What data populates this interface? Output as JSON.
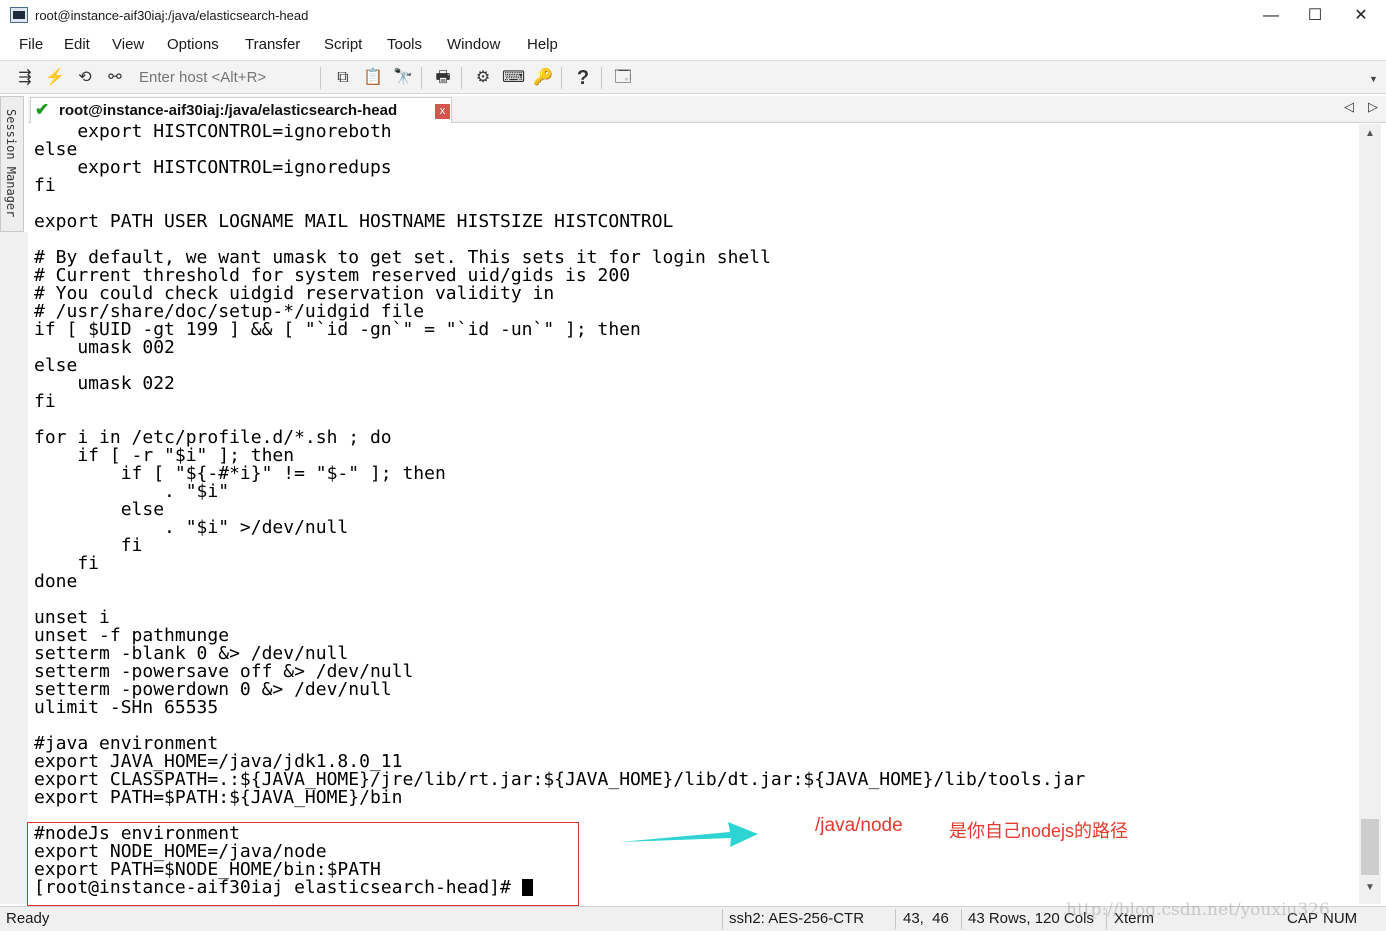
{
  "window": {
    "title": "root@instance-aif30iaj:/java/elasticsearch-head",
    "minimize": "—",
    "maximize": "☐",
    "close": "✕"
  },
  "menu": [
    "File",
    "Edit",
    "View",
    "Options",
    "Transfer",
    "Script",
    "Tools",
    "Window",
    "Help"
  ],
  "toolbar": {
    "host_placeholder": "Enter host <Alt+R>",
    "icons": [
      "connect-icon",
      "quick-connect-icon",
      "reconnect-icon",
      "disconnect-icon",
      "copy-icon",
      "paste-icon",
      "find-icon",
      "print-icon",
      "settings-icon",
      "keymap-icon",
      "key-icon",
      "help-icon",
      "sftp-icon"
    ]
  },
  "session_manager": {
    "label": "Session Manager"
  },
  "tab": {
    "label": "root@instance-aif30iaj:/java/elasticsearch-head",
    "close": "x",
    "prev": "◁",
    "next": "▷"
  },
  "terminal": {
    "lines": [
      "    export HISTCONTROL=ignoreboth",
      "else",
      "    export HISTCONTROL=ignoredups",
      "fi",
      "",
      "export PATH USER LOGNAME MAIL HOSTNAME HISTSIZE HISTCONTROL",
      "",
      "# By default, we want umask to get set. This sets it for login shell",
      "# Current threshold for system reserved uid/gids is 200",
      "# You could check uidgid reservation validity in",
      "# /usr/share/doc/setup-*/uidgid file",
      "if [ $UID -gt 199 ] && [ \"`id -gn`\" = \"`id -un`\" ]; then",
      "    umask 002",
      "else",
      "    umask 022",
      "fi",
      "",
      "for i in /etc/profile.d/*.sh ; do",
      "    if [ -r \"$i\" ]; then",
      "        if [ \"${-#*i}\" != \"$-\" ]; then",
      "            . \"$i\"",
      "        else",
      "            . \"$i\" >/dev/null",
      "        fi",
      "    fi",
      "done",
      "",
      "unset i",
      "unset -f pathmunge",
      "setterm -blank 0 &> /dev/null",
      "setterm -powersave off &> /dev/null",
      "setterm -powerdown 0 &> /dev/null",
      "ulimit -SHn 65535",
      "",
      "#java environment",
      "export JAVA_HOME=/java/jdk1.8.0_11",
      "export CLASSPATH=.:${JAVA_HOME}/jre/lib/rt.jar:${JAVA_HOME}/lib/dt.jar:${JAVA_HOME}/lib/tools.jar",
      "export PATH=$PATH:${JAVA_HOME}/bin",
      "",
      "#nodeJs environment",
      "export NODE_HOME=/java/node",
      "export PATH=$NODE_HOME/bin:$PATH"
    ],
    "prompt": "[root@instance-aif30iaj elasticsearch-head]# "
  },
  "annotation": {
    "path": "/java/node",
    "note": "是你自己nodejs的路径"
  },
  "status": {
    "ready": "Ready",
    "cipher": "ssh2: AES-256-CTR",
    "cursor_pos": "43,  46",
    "size": "43 Rows, 120 Cols",
    "term": "Xterm",
    "cap": "CAP",
    "num": "NUM"
  },
  "watermark": "http://blog.csdn.net/youxiu326",
  "colors": {
    "annotation_red": "#e53a2e",
    "arrow_cyan": "#2ed4d4",
    "tab_check_green": "#1a9c1a"
  }
}
